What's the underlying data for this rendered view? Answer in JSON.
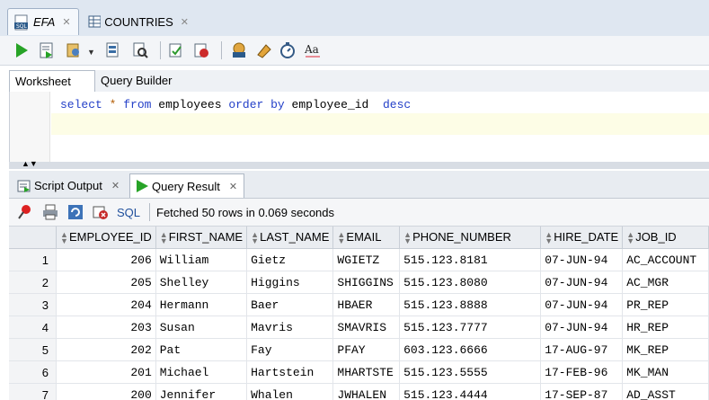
{
  "doc_tabs": [
    {
      "label": "EFA",
      "active": true,
      "icon": "sql-file-icon"
    },
    {
      "label": "COUNTRIES",
      "active": false,
      "icon": "table-icon"
    }
  ],
  "worksheet_tabs": [
    "Worksheet",
    "Query Builder"
  ],
  "editor": {
    "tokens": {
      "select": "select",
      "star": "*",
      "from": "from",
      "table": "employees",
      "order_by": "order by",
      "column": "employee_id",
      "desc": "desc"
    }
  },
  "result_tabs": [
    {
      "label": "Script Output",
      "active": false
    },
    {
      "label": "Query Result",
      "active": true
    }
  ],
  "result_toolbar": {
    "sql_label": "SQL",
    "status": "Fetched 50 rows in 0.069 seconds"
  },
  "grid": {
    "columns": [
      "EMPLOYEE_ID",
      "FIRST_NAME",
      "LAST_NAME",
      "EMAIL",
      "PHONE_NUMBER",
      "HIRE_DATE",
      "JOB_ID"
    ],
    "rows": [
      {
        "n": "1",
        "c": [
          "206",
          "William",
          "Gietz",
          "WGIETZ",
          "515.123.8181",
          "07-JUN-94",
          "AC_ACCOUNT"
        ]
      },
      {
        "n": "2",
        "c": [
          "205",
          "Shelley",
          "Higgins",
          "SHIGGINS",
          "515.123.8080",
          "07-JUN-94",
          "AC_MGR"
        ]
      },
      {
        "n": "3",
        "c": [
          "204",
          "Hermann",
          "Baer",
          "HBAER",
          "515.123.8888",
          "07-JUN-94",
          "PR_REP"
        ]
      },
      {
        "n": "4",
        "c": [
          "203",
          "Susan",
          "Mavris",
          "SMAVRIS",
          "515.123.7777",
          "07-JUN-94",
          "HR_REP"
        ]
      },
      {
        "n": "5",
        "c": [
          "202",
          "Pat",
          "Fay",
          "PFAY",
          "603.123.6666",
          "17-AUG-97",
          "MK_REP"
        ]
      },
      {
        "n": "6",
        "c": [
          "201",
          "Michael",
          "Hartstein",
          "MHARTSTE",
          "515.123.5555",
          "17-FEB-96",
          "MK_MAN"
        ]
      },
      {
        "n": "7",
        "c": [
          "200",
          "Jennifer",
          "Whalen",
          "JWHALEN",
          "515.123.4444",
          "17-SEP-87",
          "AD_ASST"
        ]
      }
    ]
  }
}
